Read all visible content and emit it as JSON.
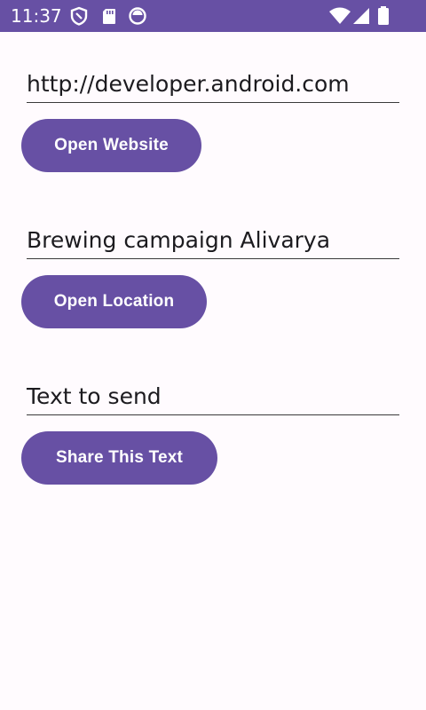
{
  "status_bar": {
    "time": "11:37",
    "left_icons": [
      "shield-icon",
      "sd-card-icon",
      "circle-status-icon"
    ],
    "right_icons": [
      "wifi-icon",
      "cell-signal-icon",
      "battery-icon"
    ],
    "background_color": "#6750A4"
  },
  "form": {
    "url_field": {
      "value": "http://developer.android.com"
    },
    "open_website_button": {
      "label": "Open Website"
    },
    "location_field": {
      "value": "Brewing campaign Alivarya"
    },
    "open_location_button": {
      "label": "Open Location"
    },
    "share_field": {
      "value": "Text to send"
    },
    "share_button": {
      "label": "Share This Text"
    }
  },
  "colors": {
    "accent": "#6750A4",
    "background": "#FFFBFE",
    "text": "#1C1B1F"
  }
}
